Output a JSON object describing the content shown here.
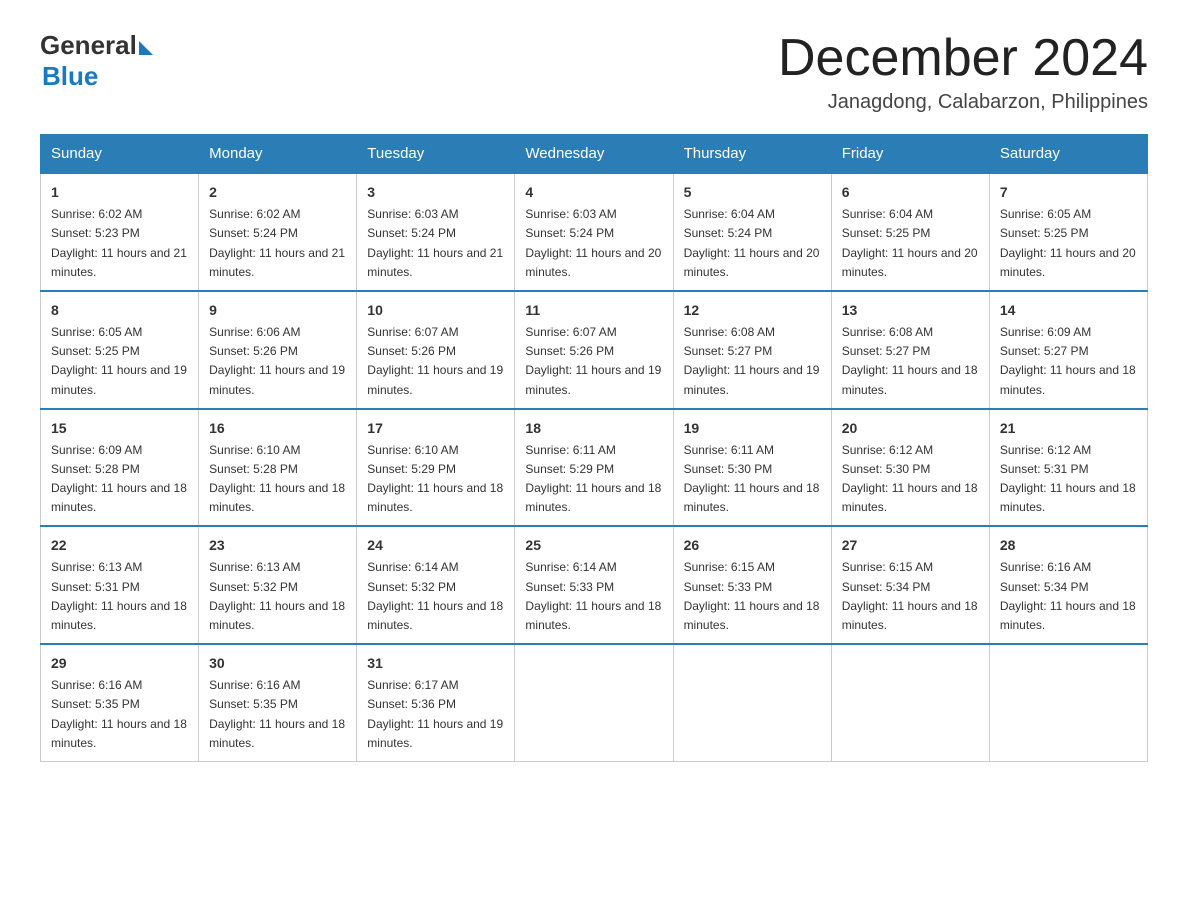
{
  "logo": {
    "general": "General",
    "blue": "Blue"
  },
  "title": "December 2024",
  "location": "Janagdong, Calabarzon, Philippines",
  "days_of_week": [
    "Sunday",
    "Monday",
    "Tuesday",
    "Wednesday",
    "Thursday",
    "Friday",
    "Saturday"
  ],
  "weeks": [
    [
      {
        "day": "1",
        "sunrise": "6:02 AM",
        "sunset": "5:23 PM",
        "daylight": "11 hours and 21 minutes."
      },
      {
        "day": "2",
        "sunrise": "6:02 AM",
        "sunset": "5:24 PM",
        "daylight": "11 hours and 21 minutes."
      },
      {
        "day": "3",
        "sunrise": "6:03 AM",
        "sunset": "5:24 PM",
        "daylight": "11 hours and 21 minutes."
      },
      {
        "day": "4",
        "sunrise": "6:03 AM",
        "sunset": "5:24 PM",
        "daylight": "11 hours and 20 minutes."
      },
      {
        "day": "5",
        "sunrise": "6:04 AM",
        "sunset": "5:24 PM",
        "daylight": "11 hours and 20 minutes."
      },
      {
        "day": "6",
        "sunrise": "6:04 AM",
        "sunset": "5:25 PM",
        "daylight": "11 hours and 20 minutes."
      },
      {
        "day": "7",
        "sunrise": "6:05 AM",
        "sunset": "5:25 PM",
        "daylight": "11 hours and 20 minutes."
      }
    ],
    [
      {
        "day": "8",
        "sunrise": "6:05 AM",
        "sunset": "5:25 PM",
        "daylight": "11 hours and 19 minutes."
      },
      {
        "day": "9",
        "sunrise": "6:06 AM",
        "sunset": "5:26 PM",
        "daylight": "11 hours and 19 minutes."
      },
      {
        "day": "10",
        "sunrise": "6:07 AM",
        "sunset": "5:26 PM",
        "daylight": "11 hours and 19 minutes."
      },
      {
        "day": "11",
        "sunrise": "6:07 AM",
        "sunset": "5:26 PM",
        "daylight": "11 hours and 19 minutes."
      },
      {
        "day": "12",
        "sunrise": "6:08 AM",
        "sunset": "5:27 PM",
        "daylight": "11 hours and 19 minutes."
      },
      {
        "day": "13",
        "sunrise": "6:08 AM",
        "sunset": "5:27 PM",
        "daylight": "11 hours and 18 minutes."
      },
      {
        "day": "14",
        "sunrise": "6:09 AM",
        "sunset": "5:27 PM",
        "daylight": "11 hours and 18 minutes."
      }
    ],
    [
      {
        "day": "15",
        "sunrise": "6:09 AM",
        "sunset": "5:28 PM",
        "daylight": "11 hours and 18 minutes."
      },
      {
        "day": "16",
        "sunrise": "6:10 AM",
        "sunset": "5:28 PM",
        "daylight": "11 hours and 18 minutes."
      },
      {
        "day": "17",
        "sunrise": "6:10 AM",
        "sunset": "5:29 PM",
        "daylight": "11 hours and 18 minutes."
      },
      {
        "day": "18",
        "sunrise": "6:11 AM",
        "sunset": "5:29 PM",
        "daylight": "11 hours and 18 minutes."
      },
      {
        "day": "19",
        "sunrise": "6:11 AM",
        "sunset": "5:30 PM",
        "daylight": "11 hours and 18 minutes."
      },
      {
        "day": "20",
        "sunrise": "6:12 AM",
        "sunset": "5:30 PM",
        "daylight": "11 hours and 18 minutes."
      },
      {
        "day": "21",
        "sunrise": "6:12 AM",
        "sunset": "5:31 PM",
        "daylight": "11 hours and 18 minutes."
      }
    ],
    [
      {
        "day": "22",
        "sunrise": "6:13 AM",
        "sunset": "5:31 PM",
        "daylight": "11 hours and 18 minutes."
      },
      {
        "day": "23",
        "sunrise": "6:13 AM",
        "sunset": "5:32 PM",
        "daylight": "11 hours and 18 minutes."
      },
      {
        "day": "24",
        "sunrise": "6:14 AM",
        "sunset": "5:32 PM",
        "daylight": "11 hours and 18 minutes."
      },
      {
        "day": "25",
        "sunrise": "6:14 AM",
        "sunset": "5:33 PM",
        "daylight": "11 hours and 18 minutes."
      },
      {
        "day": "26",
        "sunrise": "6:15 AM",
        "sunset": "5:33 PM",
        "daylight": "11 hours and 18 minutes."
      },
      {
        "day": "27",
        "sunrise": "6:15 AM",
        "sunset": "5:34 PM",
        "daylight": "11 hours and 18 minutes."
      },
      {
        "day": "28",
        "sunrise": "6:16 AM",
        "sunset": "5:34 PM",
        "daylight": "11 hours and 18 minutes."
      }
    ],
    [
      {
        "day": "29",
        "sunrise": "6:16 AM",
        "sunset": "5:35 PM",
        "daylight": "11 hours and 18 minutes."
      },
      {
        "day": "30",
        "sunrise": "6:16 AM",
        "sunset": "5:35 PM",
        "daylight": "11 hours and 18 minutes."
      },
      {
        "day": "31",
        "sunrise": "6:17 AM",
        "sunset": "5:36 PM",
        "daylight": "11 hours and 19 minutes."
      },
      null,
      null,
      null,
      null
    ]
  ]
}
